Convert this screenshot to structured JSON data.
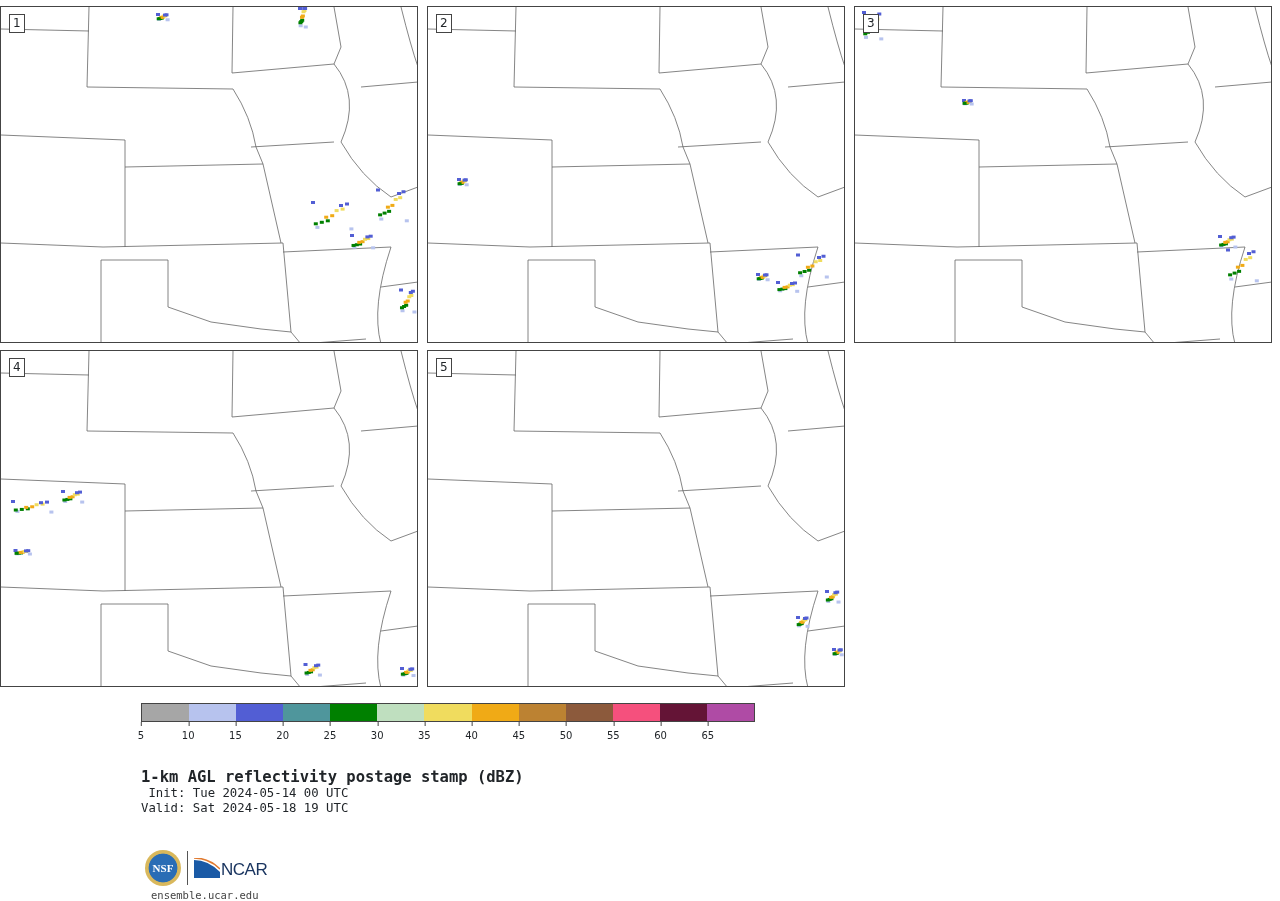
{
  "panels": [
    {
      "label": "1"
    },
    {
      "label": "2"
    },
    {
      "label": "3"
    },
    {
      "label": "4"
    },
    {
      "label": "5"
    }
  ],
  "colorbar": {
    "segments": [
      {
        "color": "#a6a6a6"
      },
      {
        "color": "#b7c3ee"
      },
      {
        "color": "#525ed4"
      },
      {
        "color": "#4f969c"
      },
      {
        "color": "#008000"
      },
      {
        "color": "#bfdfbf"
      },
      {
        "color": "#f0dc5e"
      },
      {
        "color": "#f0aa16"
      },
      {
        "color": "#bc8232"
      },
      {
        "color": "#8c5a3c"
      },
      {
        "color": "#f5507d"
      },
      {
        "color": "#641436"
      },
      {
        "color": "#af4ba5"
      }
    ],
    "ticks": [
      "5",
      "10",
      "15",
      "20",
      "25",
      "30",
      "35",
      "40",
      "45",
      "50",
      "55",
      "60",
      "65"
    ]
  },
  "title": "1-km AGL reflectivity postage stamp (dBZ)",
  "init": " Init: Tue 2024-05-14 00 UTC",
  "valid": "Valid: Sat 2024-05-18 19 UTC",
  "logos": {
    "nsf": "NSF",
    "ncar": "NCAR"
  },
  "url": "ensemble.ucar.edu"
}
